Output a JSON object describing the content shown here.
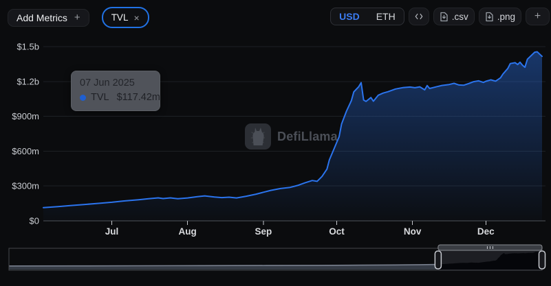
{
  "header": {
    "add_metrics": {
      "label": "Add Metrics",
      "plus": "+"
    },
    "metric_pill": {
      "label": "TVL",
      "close": "×"
    },
    "currency": {
      "usd": "USD",
      "eth": "ETH",
      "active": "USD"
    },
    "export": {
      "csv": ".csv",
      "png": ".png",
      "add": "+"
    }
  },
  "tooltip": {
    "date": "07 Jun 2025",
    "series": "TVL",
    "value": "$117.42m"
  },
  "watermark": {
    "text": "DefiLlama"
  },
  "colors": {
    "accent": "#2172e5",
    "line": "#2b74ee",
    "area_top": "rgba(43,116,238,0.42)",
    "area_bottom": "rgba(43,116,238,0.02)",
    "grid": "#1e2125",
    "axis": "#515459",
    "y_label": "#c9ccd1",
    "x_label": "#d8dadd",
    "tooltip_dot": "#1f5fd0",
    "slider_border": "#45474c",
    "slider_history_fill": "#3a404b",
    "slider_history_line": "#79808e",
    "slider_selection_bg": "#1d1e23",
    "slider_mini_fill": "#05060a",
    "slider_handle_stroke": "#c7cad0",
    "slider_bar_fill": "#3a3d43",
    "slider_bar_stroke": "#8b8e94"
  },
  "chart_data": {
    "type": "area",
    "title": "TVL (USD)",
    "legend": [
      "TVL"
    ],
    "y_unit": "million USD",
    "x_domain": [
      "2025-06-03",
      "2025-12-24"
    ],
    "y_domain": [
      0,
      1500
    ],
    "grid": "horizontal",
    "x_ticks": [
      {
        "label": "Jul",
        "date": "2025-07-01"
      },
      {
        "label": "Aug",
        "date": "2025-08-01"
      },
      {
        "label": "Sep",
        "date": "2025-09-01"
      },
      {
        "label": "Oct",
        "date": "2025-10-01"
      },
      {
        "label": "Nov",
        "date": "2025-11-01"
      },
      {
        "label": "Dec",
        "date": "2025-12-01"
      }
    ],
    "y_ticks": [
      {
        "label": "$0",
        "value": 0
      },
      {
        "label": "$300m",
        "value": 300
      },
      {
        "label": "$600m",
        "value": 600
      },
      {
        "label": "$900m",
        "value": 900
      },
      {
        "label": "$1.2b",
        "value": 1200
      },
      {
        "label": "$1.5b",
        "value": 1500
      }
    ],
    "highlighted_point": {
      "date": "2025-06-07",
      "value_label": "$117.42m",
      "value": 117.42
    },
    "points": [
      [
        "2025-06-03",
        114
      ],
      [
        "2025-06-09",
        122
      ],
      [
        "2025-06-14",
        131
      ],
      [
        "2025-06-20",
        141
      ],
      [
        "2025-06-26",
        151
      ],
      [
        "2025-07-01",
        160
      ],
      [
        "2025-07-06",
        171
      ],
      [
        "2025-07-12",
        182
      ],
      [
        "2025-07-16",
        191
      ],
      [
        "2025-07-20",
        198
      ],
      [
        "2025-07-22",
        192
      ],
      [
        "2025-07-25",
        198
      ],
      [
        "2025-07-28",
        190
      ],
      [
        "2025-08-01",
        197
      ],
      [
        "2025-08-05",
        208
      ],
      [
        "2025-08-08",
        215
      ],
      [
        "2025-08-12",
        205
      ],
      [
        "2025-08-15",
        200
      ],
      [
        "2025-08-18",
        204
      ],
      [
        "2025-08-21",
        197
      ],
      [
        "2025-08-25",
        212
      ],
      [
        "2025-08-29",
        230
      ],
      [
        "2025-09-01",
        246
      ],
      [
        "2025-09-04",
        262
      ],
      [
        "2025-09-08",
        278
      ],
      [
        "2025-09-12",
        288
      ],
      [
        "2025-09-15",
        305
      ],
      [
        "2025-09-18",
        327
      ],
      [
        "2025-09-21",
        347
      ],
      [
        "2025-09-23",
        340
      ],
      [
        "2025-09-25",
        382
      ],
      [
        "2025-09-27",
        445
      ],
      [
        "2025-09-28",
        525
      ],
      [
        "2025-09-30",
        625
      ],
      [
        "2025-10-02",
        725
      ],
      [
        "2025-10-03",
        835
      ],
      [
        "2025-10-05",
        945
      ],
      [
        "2025-10-07",
        1035
      ],
      [
        "2025-10-08",
        1110
      ],
      [
        "2025-10-10",
        1155
      ],
      [
        "2025-10-11",
        1190
      ],
      [
        "2025-10-12",
        1040
      ],
      [
        "2025-10-13",
        1028
      ],
      [
        "2025-10-15",
        1062
      ],
      [
        "2025-10-16",
        1030
      ],
      [
        "2025-10-18",
        1082
      ],
      [
        "2025-10-20",
        1100
      ],
      [
        "2025-10-22",
        1112
      ],
      [
        "2025-10-25",
        1135
      ],
      [
        "2025-10-28",
        1147
      ],
      [
        "2025-10-31",
        1152
      ],
      [
        "2025-11-02",
        1146
      ],
      [
        "2025-11-04",
        1154
      ],
      [
        "2025-11-06",
        1128
      ],
      [
        "2025-11-07",
        1165
      ],
      [
        "2025-11-08",
        1140
      ],
      [
        "2025-11-11",
        1156
      ],
      [
        "2025-11-13",
        1166
      ],
      [
        "2025-11-16",
        1174
      ],
      [
        "2025-11-18",
        1184
      ],
      [
        "2025-11-20",
        1170
      ],
      [
        "2025-11-22",
        1168
      ],
      [
        "2025-11-24",
        1182
      ],
      [
        "2025-11-26",
        1198
      ],
      [
        "2025-11-28",
        1206
      ],
      [
        "2025-11-30",
        1192
      ],
      [
        "2025-12-01",
        1202
      ],
      [
        "2025-12-03",
        1214
      ],
      [
        "2025-12-05",
        1203
      ],
      [
        "2025-12-07",
        1232
      ],
      [
        "2025-12-08",
        1264
      ],
      [
        "2025-12-10",
        1312
      ],
      [
        "2025-12-11",
        1354
      ],
      [
        "2025-12-13",
        1362
      ],
      [
        "2025-12-14",
        1346
      ],
      [
        "2025-12-15",
        1366
      ],
      [
        "2025-12-16",
        1340
      ],
      [
        "2025-12-17",
        1322
      ],
      [
        "2025-12-18",
        1392
      ],
      [
        "2025-12-20",
        1432
      ],
      [
        "2025-12-21",
        1452
      ],
      [
        "2025-12-22",
        1456
      ],
      [
        "2025-12-23",
        1436
      ],
      [
        "2025-12-24",
        1416
      ]
    ]
  },
  "slider": {
    "selected_range_frac": [
      0.805,
      1.0
    ],
    "history_points": [
      [
        0,
        55
      ],
      [
        0.15,
        58
      ],
      [
        0.3,
        62
      ],
      [
        0.45,
        66
      ],
      [
        0.6,
        71
      ],
      [
        0.72,
        76
      ],
      [
        0.82,
        83
      ],
      [
        0.9,
        93
      ],
      [
        0.96,
        104
      ],
      [
        1,
        112
      ]
    ]
  }
}
